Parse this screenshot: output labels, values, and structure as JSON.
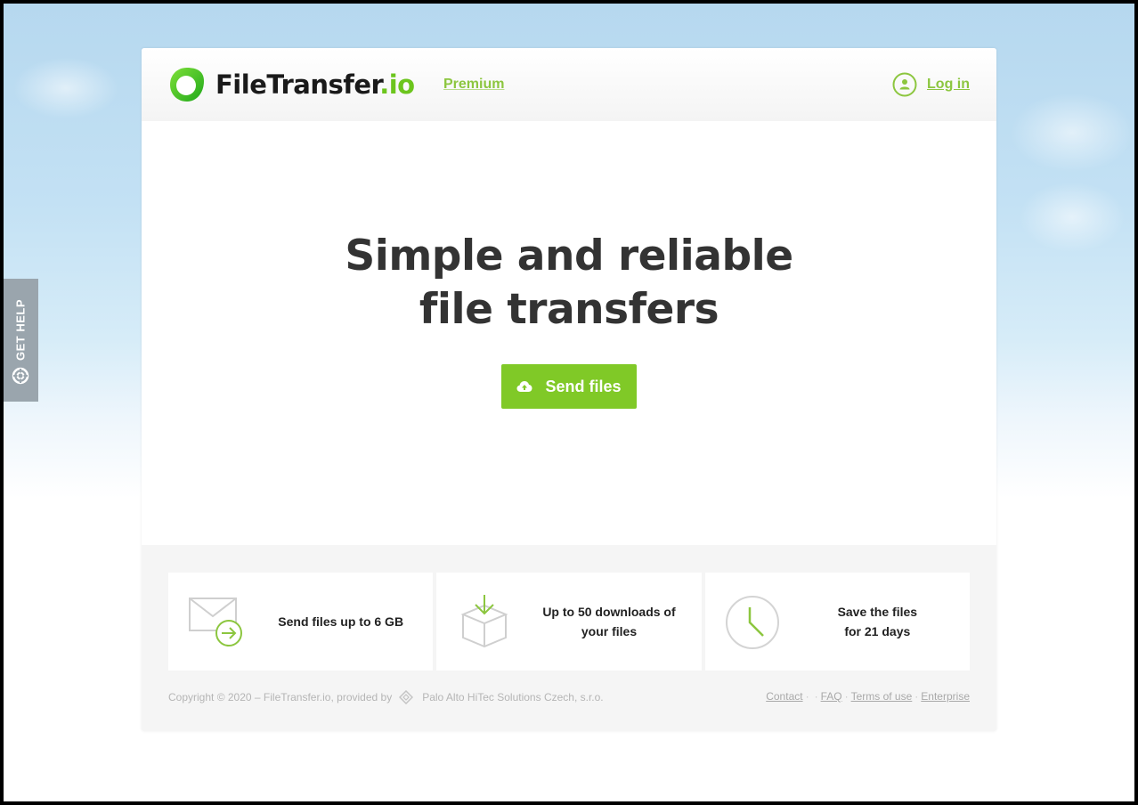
{
  "header": {
    "logo": {
      "name": "FileTransfer",
      "tld": ".io",
      "icon": "logo-ring-icon"
    },
    "premium_label": "Premium",
    "login_label": "Log in",
    "login_icon": "user-circle-icon"
  },
  "hero": {
    "title_line1": "Simple and reliable",
    "title_line2": "file transfers",
    "send_button_label": "Send files",
    "send_button_icon": "cloud-upload-icon"
  },
  "features": [
    {
      "icon": "envelope-arrow-icon",
      "text": "Send files up to 6 GB"
    },
    {
      "icon": "box-download-icon",
      "text_line1": "Up to 50 downloads of",
      "text_line2": "your files"
    },
    {
      "icon": "clock-icon",
      "text_line1": "Save the files",
      "text_line2": "for 21 days"
    }
  ],
  "footer": {
    "copyright": "Copyright © 2020 – FileTransfer.io, provided by",
    "company_icon": "diamond-logo-icon",
    "company": "Palo Alto HiTec Solutions Czech, s.r.o.",
    "links": [
      "Contact",
      "FAQ",
      "Terms of use",
      "Enterprise"
    ],
    "separator": "·"
  },
  "help_tab": {
    "label": "GET HELP",
    "icon": "lifebuoy-icon"
  },
  "colors": {
    "accent": "#80c927",
    "link": "#8cc63f",
    "heading": "#333333",
    "help_tab": "#9aa5ad"
  }
}
